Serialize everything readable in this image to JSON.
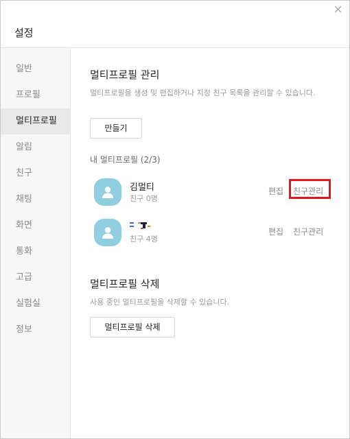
{
  "window": {
    "title": "설정",
    "close_icon": "close-icon"
  },
  "sidebar": {
    "items": [
      {
        "label": "일반"
      },
      {
        "label": "프로필"
      },
      {
        "label": "멀티프로필",
        "active": true
      },
      {
        "label": "알림"
      },
      {
        "label": "친구"
      },
      {
        "label": "채팅"
      },
      {
        "label": "화면"
      },
      {
        "label": "통화"
      },
      {
        "label": "고급"
      },
      {
        "label": "실험실"
      },
      {
        "label": "정보"
      }
    ]
  },
  "manage": {
    "title": "멀티프로필 관리",
    "description": "멀티프로필을 생성 및 편집하거나 지정 친구 목록을 관리할 수 있습니다.",
    "create_button": "만들기",
    "list_label": "내 멀티프로필 (2/3)",
    "profiles": [
      {
        "name": "김멀티",
        "friends": "친구 0명",
        "edit": "편집",
        "manage_friends": "친구관리"
      },
      {
        "name": "",
        "friends": "친구 4명",
        "edit": "편집",
        "manage_friends": "친구관리"
      }
    ]
  },
  "delete": {
    "title": "멀티프로필 삭제",
    "description": "사용 중인 멀티프로필을 삭제할 수 있습니다.",
    "button": "멀티프로필 삭제"
  },
  "colors": {
    "accent_highlight": "#e8141c",
    "avatar_bg": "#8fcfe0",
    "active_sidebar_bg": "#e9e9e9"
  }
}
